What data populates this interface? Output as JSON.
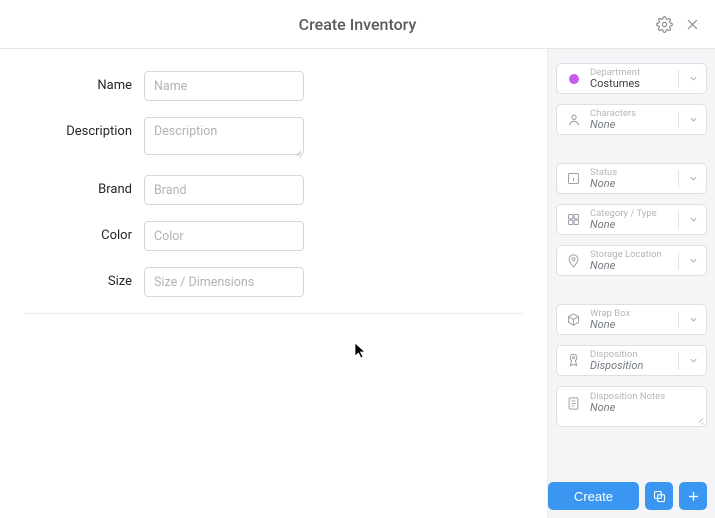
{
  "header": {
    "title": "Create Inventory"
  },
  "form": {
    "name": {
      "label": "Name",
      "placeholder": "Name",
      "value": ""
    },
    "description": {
      "label": "Description",
      "placeholder": "Description",
      "value": ""
    },
    "brand": {
      "label": "Brand",
      "placeholder": "Brand",
      "value": ""
    },
    "color": {
      "label": "Color",
      "placeholder": "Color",
      "value": ""
    },
    "size": {
      "label": "Size",
      "placeholder": "Size / Dimensions",
      "value": ""
    }
  },
  "side": {
    "department": {
      "label": "Department",
      "value": "Costumes",
      "dot_color": "#c45cf0"
    },
    "characters": {
      "label": "Characters",
      "value": "None"
    },
    "status": {
      "label": "Status",
      "value": "None"
    },
    "category": {
      "label": "Category / Type",
      "value": "None"
    },
    "storage": {
      "label": "Storage Location",
      "value": "None"
    },
    "wrapbox": {
      "label": "Wrap Box",
      "value": "None"
    },
    "disposition": {
      "label": "Disposition",
      "value": "Disposition"
    },
    "disposition_notes": {
      "label": "Disposition Notes",
      "value": "None"
    }
  },
  "footer": {
    "create_label": "Create"
  },
  "colors": {
    "primary": "#3a96f0"
  }
}
